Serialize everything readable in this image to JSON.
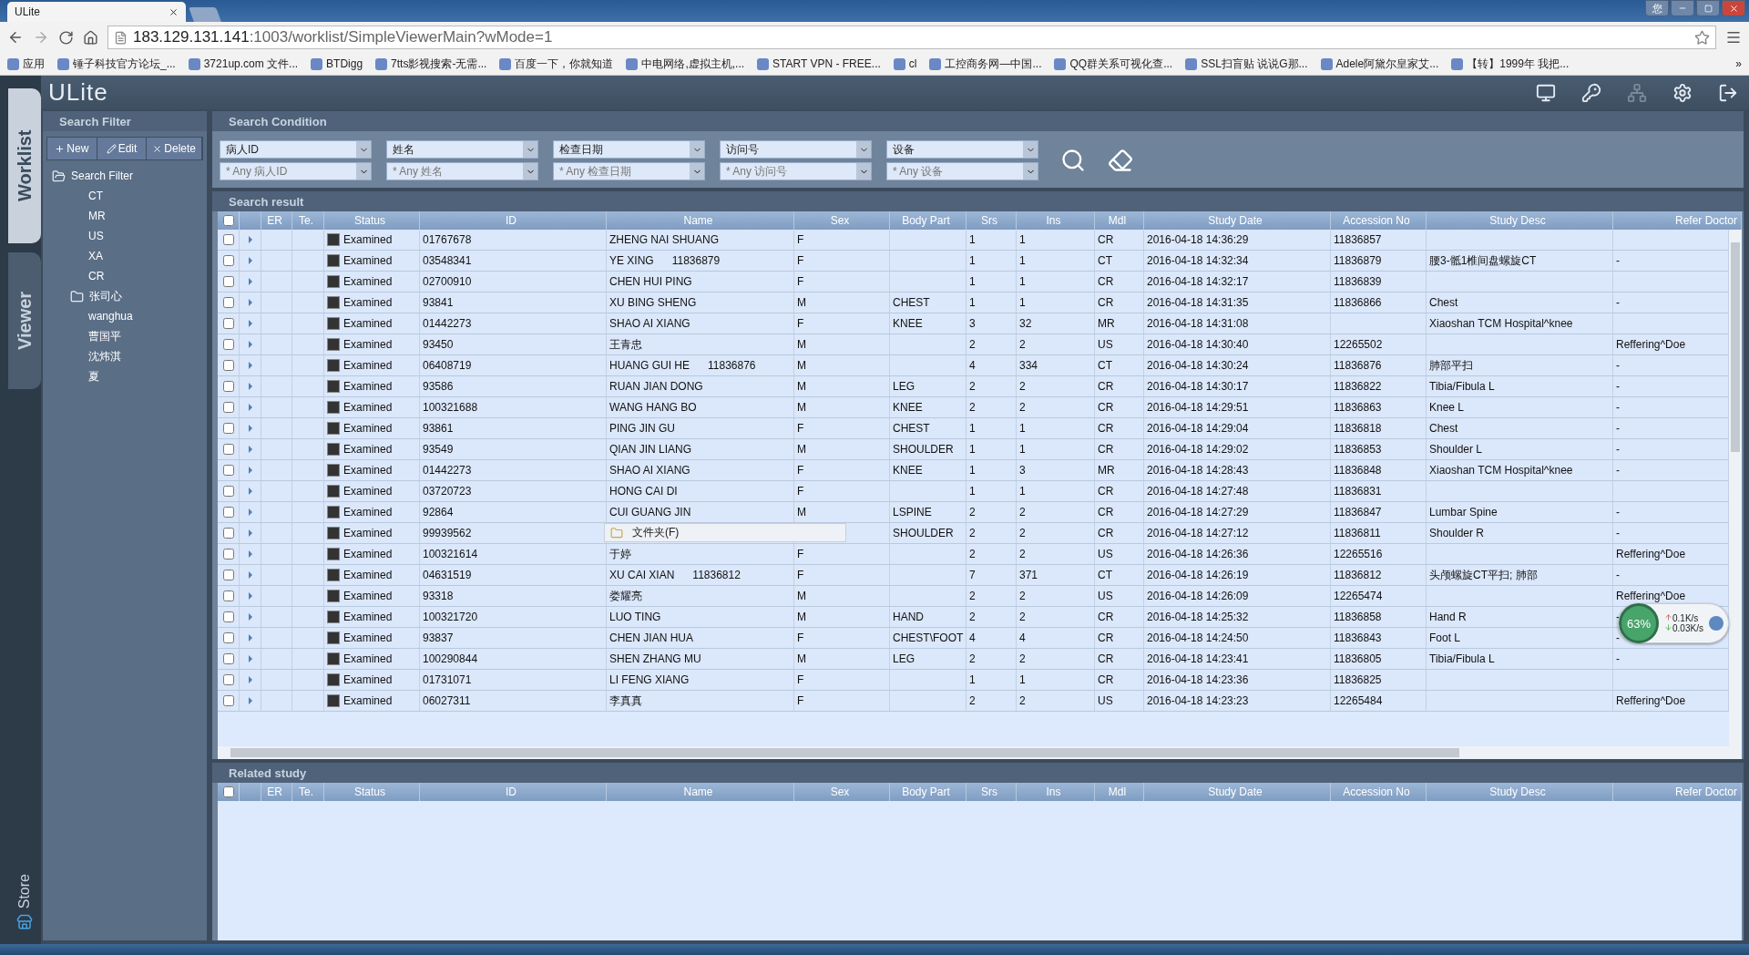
{
  "browser": {
    "tab_title": "ULite",
    "user_badge": "您",
    "url_host": "183.129.131.141",
    "url_rest": ":1003/worklist/SimpleViewerMain?wMode=1",
    "bookmarks": [
      "应用",
      "锤子科技官方论坛_...",
      "3721up.com 文件...",
      "BTDigg",
      "7tts影视搜索-无需...",
      "百度一下，你就知道",
      "中电网络,虚拟主机,...",
      "START VPN - FREE...",
      "cl",
      "工控商务网—中国...",
      "QQ群关系可视化查...",
      "SSL扫盲贴 说说G那...",
      "Adele阿黛尔皇家艾...",
      "【转】1999年 我把..."
    ],
    "bookmarks_more": "»"
  },
  "app": {
    "logo": "ULite",
    "side_tabs": [
      {
        "label": "Worklist",
        "selected": true
      },
      {
        "label": "Viewer",
        "selected": false
      }
    ],
    "store": "Store",
    "header_tools": [
      {
        "kind": "monitor",
        "disabled": false
      },
      {
        "kind": "key",
        "disabled": false
      },
      {
        "kind": "network",
        "disabled": true
      },
      {
        "kind": "settings",
        "disabled": false
      },
      {
        "kind": "logout",
        "disabled": false
      }
    ],
    "search_filter": {
      "title": "Search Filter",
      "buttons": [
        {
          "kind": "new",
          "label": "New"
        },
        {
          "kind": "edit",
          "label": "Edit"
        },
        {
          "kind": "delete",
          "label": "Delete"
        }
      ],
      "tree": [
        {
          "label": "Search Filter",
          "kind": "folder",
          "expanded": true,
          "children": [
            {
              "label": "CT",
              "kind": "leaf"
            },
            {
              "label": "MR",
              "kind": "leaf"
            },
            {
              "label": "US",
              "kind": "leaf"
            },
            {
              "label": "XA",
              "kind": "leaf"
            },
            {
              "label": "CR",
              "kind": "leaf"
            },
            {
              "label": "张司心",
              "kind": "folder",
              "expanded": false
            },
            {
              "label": "wanghua",
              "kind": "leaf"
            },
            {
              "label": "曹国平",
              "kind": "leaf"
            },
            {
              "label": "沈炜淇",
              "kind": "leaf"
            },
            {
              "label": "夏",
              "kind": "leaf"
            }
          ]
        }
      ]
    },
    "search_condition": {
      "title": "Search Condition",
      "fields": [
        {
          "field": "病人ID",
          "placeholder": "* Any 病人ID"
        },
        {
          "field": "姓名",
          "placeholder": "* Any 姓名"
        },
        {
          "field": "检查日期",
          "placeholder": "* Any 检查日期"
        },
        {
          "field": "访问号",
          "placeholder": "* Any 访问号"
        },
        {
          "field": "设备",
          "placeholder": "* Any 设备"
        }
      ]
    },
    "search_result": {
      "title": "Search result",
      "header_checked": false,
      "columns": [
        "ER",
        "Te.",
        "Status",
        "ID",
        "Name",
        "Sex",
        "Body Part",
        "Srs",
        "Ins",
        "Mdl",
        "Study Date",
        "Accession No",
        "Study Desc",
        "Refer Doctor"
      ],
      "rows": [
        {
          "checked": false,
          "status": "Examined",
          "id": "01767678",
          "name": "ZHENG NAI SHUANG",
          "sex": "F",
          "srs": "1",
          "ins": "1",
          "mdl": "CR",
          "study_date": "2016-04-18 14:36:29",
          "accession_no": "11836857"
        },
        {
          "checked": false,
          "status": "Examined",
          "id": "03548341",
          "name": "YE XING      11836879",
          "sex": "F",
          "srs": "1",
          "ins": "1",
          "mdl": "CT",
          "study_date": "2016-04-18 14:32:34",
          "accession_no": "11836879",
          "study_desc": "腰3-骶1椎间盘螺旋CT",
          "refer_doctor": "-"
        },
        {
          "checked": false,
          "status": "Examined",
          "id": "02700910",
          "name": "CHEN HUI PING",
          "sex": "F",
          "srs": "1",
          "ins": "1",
          "mdl": "CR",
          "study_date": "2016-04-18 14:32:17",
          "accession_no": "11836839"
        },
        {
          "checked": false,
          "status": "Examined",
          "id": "93841",
          "name": "XU BING SHENG",
          "sex": "M",
          "body_part": "CHEST",
          "srs": "1",
          "ins": "1",
          "mdl": "CR",
          "study_date": "2016-04-18 14:31:35",
          "accession_no": "11836866",
          "study_desc": "Chest",
          "refer_doctor": "-"
        },
        {
          "checked": false,
          "status": "Examined",
          "id": "01442273",
          "name": "SHAO AI XIANG",
          "sex": "F",
          "body_part": "KNEE",
          "srs": "3",
          "ins": "32",
          "mdl": "MR",
          "study_date": "2016-04-18 14:31:08",
          "study_desc": "Xiaoshan TCM Hospital^knee"
        },
        {
          "checked": false,
          "status": "Examined",
          "id": "93450",
          "name": "王青忠",
          "sex": "M",
          "srs": "2",
          "ins": "2",
          "mdl": "US",
          "study_date": "2016-04-18 14:30:40",
          "accession_no": "12265502",
          "refer_doctor": "Reffering^Doe"
        },
        {
          "checked": false,
          "status": "Examined",
          "id": "06408719",
          "name": "HUANG GUI HE      11836876",
          "sex": "M",
          "srs": "4",
          "ins": "334",
          "mdl": "CT",
          "study_date": "2016-04-18 14:30:24",
          "accession_no": "11836876",
          "study_desc": "肺部平扫",
          "refer_doctor": "-"
        },
        {
          "checked": false,
          "status": "Examined",
          "id": "93586",
          "name": "RUAN JIAN DONG",
          "sex": "M",
          "body_part": "LEG",
          "srs": "2",
          "ins": "2",
          "mdl": "CR",
          "study_date": "2016-04-18 14:30:17",
          "accession_no": "11836822",
          "study_desc": "Tibia/Fibula L",
          "refer_doctor": "-"
        },
        {
          "checked": false,
          "status": "Examined",
          "id": "100321688",
          "name": "WANG HANG BO",
          "sex": "M",
          "body_part": "KNEE",
          "srs": "2",
          "ins": "2",
          "mdl": "CR",
          "study_date": "2016-04-18 14:29:51",
          "accession_no": "11836863",
          "study_desc": "Knee L",
          "refer_doctor": "-"
        },
        {
          "checked": false,
          "status": "Examined",
          "id": "93861",
          "name": "PING JIN GU",
          "sex": "F",
          "body_part": "CHEST",
          "srs": "1",
          "ins": "1",
          "mdl": "CR",
          "study_date": "2016-04-18 14:29:04",
          "accession_no": "11836818",
          "study_desc": "Chest",
          "refer_doctor": "-"
        },
        {
          "checked": false,
          "status": "Examined",
          "id": "93549",
          "name": "QIAN JIN LIANG",
          "sex": "M",
          "body_part": "SHOULDER",
          "srs": "1",
          "ins": "1",
          "mdl": "CR",
          "study_date": "2016-04-18 14:29:02",
          "accession_no": "11836853",
          "study_desc": "Shoulder L",
          "refer_doctor": "-"
        },
        {
          "checked": false,
          "status": "Examined",
          "id": "01442273",
          "name": "SHAO AI XIANG",
          "sex": "F",
          "body_part": "KNEE",
          "srs": "1",
          "ins": "3",
          "mdl": "MR",
          "study_date": "2016-04-18 14:28:43",
          "accession_no": "11836848",
          "study_desc": "Xiaoshan TCM Hospital^knee",
          "refer_doctor": "-"
        },
        {
          "checked": false,
          "status": "Examined",
          "id": "03720723",
          "name": "HONG CAI DI",
          "sex": "F",
          "srs": "1",
          "ins": "1",
          "mdl": "CR",
          "study_date": "2016-04-18 14:27:48",
          "accession_no": "11836831"
        },
        {
          "checked": false,
          "status": "Examined",
          "id": "92864",
          "name": "CUI GUANG JIN",
          "sex": "M",
          "body_part": "LSPINE",
          "srs": "2",
          "ins": "2",
          "mdl": "CR",
          "study_date": "2016-04-18 14:27:29",
          "accession_no": "11836847",
          "study_desc": "Lumbar Spine",
          "refer_doctor": "-"
        },
        {
          "checked": false,
          "status": "Examined",
          "id": "99939562",
          "context_menu": {
            "item": "文件夹(F)"
          },
          "body_part": "SHOULDER",
          "srs": "2",
          "ins": "2",
          "mdl": "CR",
          "study_date": "2016-04-18 14:27:12",
          "accession_no": "11836811",
          "study_desc": "Shoulder R",
          "refer_doctor": "-"
        },
        {
          "checked": false,
          "status": "Examined",
          "id": "100321614",
          "name": "于婷",
          "sex": "F",
          "srs": "2",
          "ins": "2",
          "mdl": "US",
          "study_date": "2016-04-18 14:26:36",
          "accession_no": "12265516",
          "refer_doctor": "Reffering^Doe"
        },
        {
          "checked": false,
          "status": "Examined",
          "id": "04631519",
          "name": "XU CAI XIAN      11836812",
          "sex": "F",
          "srs": "7",
          "ins": "371",
          "mdl": "CT",
          "study_date": "2016-04-18 14:26:19",
          "accession_no": "11836812",
          "study_desc": "头颅螺旋CT平扫; 肺部",
          "refer_doctor": "-"
        },
        {
          "checked": false,
          "status": "Examined",
          "id": "93318",
          "name": "娄耀亮",
          "sex": "M",
          "srs": "2",
          "ins": "2",
          "mdl": "US",
          "study_date": "2016-04-18 14:26:09",
          "accession_no": "12265474",
          "refer_doctor": "Reffering^Doe"
        },
        {
          "checked": false,
          "status": "Examined",
          "id": "100321720",
          "name": "LUO TING",
          "sex": "M",
          "body_part": "HAND",
          "srs": "2",
          "ins": "2",
          "mdl": "CR",
          "study_date": "2016-04-18 14:25:32",
          "accession_no": "11836858",
          "study_desc": "Hand R",
          "refer_doctor": "-"
        },
        {
          "checked": false,
          "status": "Examined",
          "id": "93837",
          "name": "CHEN JIAN HUA",
          "sex": "F",
          "body_part": "CHEST\\FOOT",
          "srs": "4",
          "ins": "4",
          "mdl": "CR",
          "study_date": "2016-04-18 14:24:50",
          "accession_no": "11836843",
          "study_desc": "Foot L",
          "refer_doctor": "-"
        },
        {
          "checked": false,
          "status": "Examined",
          "id": "100290844",
          "name": "SHEN ZHANG MU",
          "sex": "M",
          "body_part": "LEG",
          "srs": "2",
          "ins": "2",
          "mdl": "CR",
          "study_date": "2016-04-18 14:23:41",
          "accession_no": "11836805",
          "study_desc": "Tibia/Fibula L",
          "refer_doctor": "-"
        },
        {
          "checked": false,
          "status": "Examined",
          "id": "01731071",
          "name": "LI FENG XIANG",
          "sex": "F",
          "srs": "1",
          "ins": "1",
          "mdl": "CR",
          "study_date": "2016-04-18 14:23:36",
          "accession_no": "11836825"
        },
        {
          "checked": false,
          "status": "Examined",
          "id": "06027311",
          "name": "李真真",
          "sex": "F",
          "srs": "2",
          "ins": "2",
          "mdl": "US",
          "study_date": "2016-04-18 14:23:23",
          "accession_no": "12265484",
          "refer_doctor": "Reffering^Doe"
        }
      ],
      "net_widget": {
        "percent": "63%",
        "up": "0.1K/s",
        "down": "0.03K/s"
      }
    },
    "related_study": {
      "title": "Related study",
      "header_checked": false,
      "columns": [
        "ER",
        "Te.",
        "Status",
        "ID",
        "Name",
        "Sex",
        "Body Part",
        "Srs",
        "Ins",
        "Mdl",
        "Study Date",
        "Accession No",
        "Study Desc",
        "Refer Doctor"
      ]
    }
  }
}
